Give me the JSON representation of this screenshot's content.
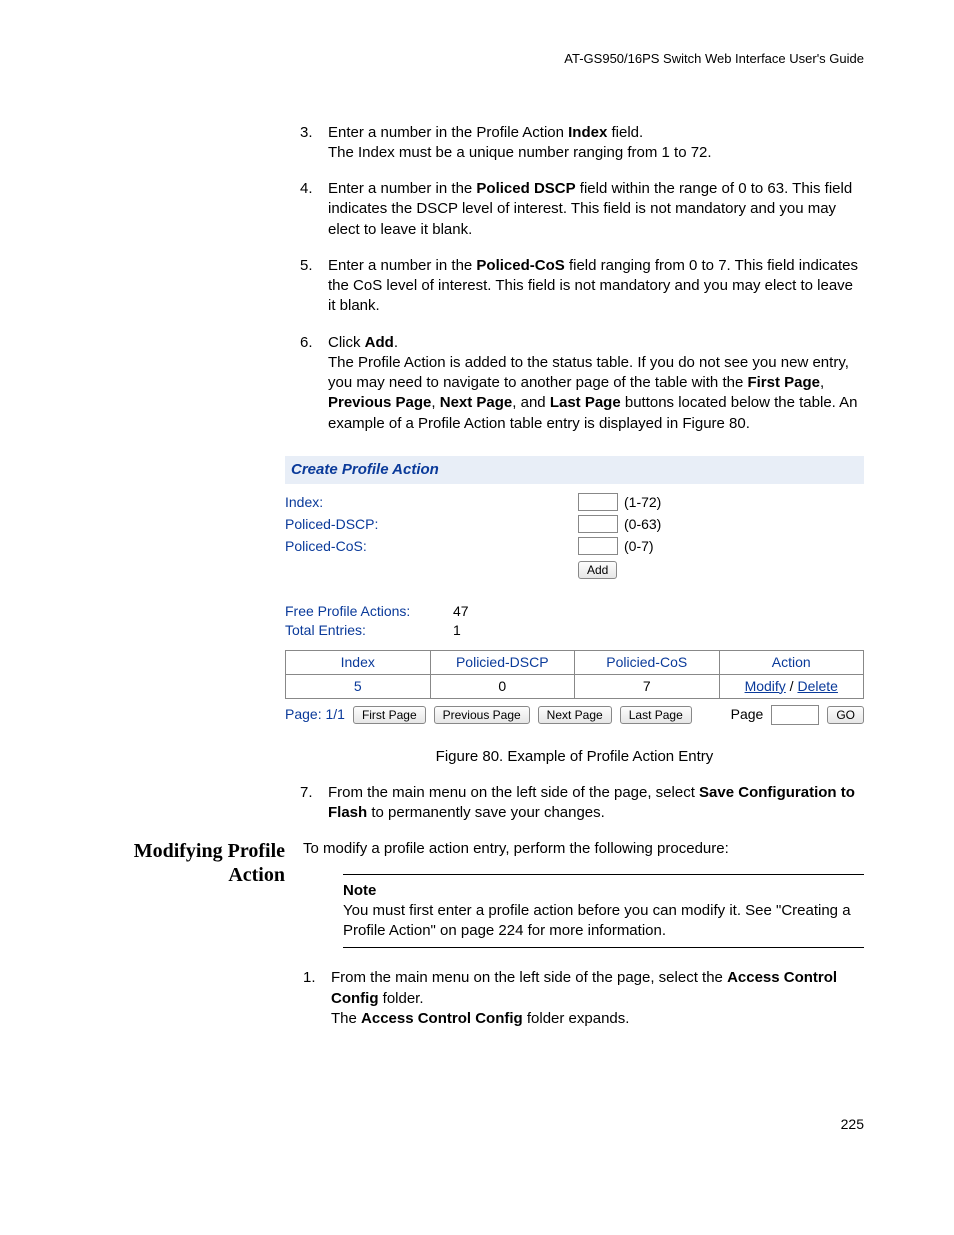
{
  "header": "AT-GS950/16PS Switch Web Interface User's Guide",
  "s3": {
    "n": "3.",
    "l1a": "Enter a number in the Profile Action ",
    "l1b": "Index",
    "l1c": " field.",
    "l2": "The Index must be a unique number ranging from 1 to 72."
  },
  "s4": {
    "n": "4.",
    "l1a": "Enter a number in the ",
    "l1b": "Policed DSCP",
    "l1c": " field within the range of 0 to 63. This field indicates the DSCP level of interest. This field is not mandatory and you may elect to leave it blank."
  },
  "s5": {
    "n": "5.",
    "l1a": "Enter a number in the ",
    "l1b": "Policed-CoS",
    "l1c": " field ranging from 0 to 7. This field indicates the CoS level of interest. This field is not mandatory and you may elect to leave it blank."
  },
  "s6": {
    "n": "6.",
    "l1a": "Click ",
    "l1b": "Add",
    "l1c": ".",
    "l2a": "The Profile Action is added to the status table. If you do not see you new entry, you may need to navigate to another page of the table with the ",
    "l2b": "First Page",
    "l2c": ", ",
    "l2d": "Previous Page",
    "l2e": ", ",
    "l2f": "Next Page",
    "l2g": ", and ",
    "l2h": "Last Page",
    "l2i": " buttons located below the table. An example of a Profile Action table entry is displayed in Figure 80."
  },
  "panel": {
    "title": "Create Profile Action",
    "rows": [
      {
        "label": "Index:",
        "hint": "(1-72)"
      },
      {
        "label": "Policed-DSCP:",
        "hint": "(0-63)"
      },
      {
        "label": "Policed-CoS:",
        "hint": "(0-7)"
      }
    ],
    "add": "Add",
    "stats": {
      "free_l": "Free Profile Actions:",
      "free_v": "47",
      "total_l": "Total Entries:",
      "total_v": "1"
    },
    "tbl": {
      "h": [
        "Index",
        "Policied-DSCP",
        "Policied-CoS",
        "Action"
      ],
      "row": {
        "c1": "5",
        "c2": "0",
        "c3": "7",
        "a1": "Modify",
        "sep": " / ",
        "a2": "Delete"
      }
    },
    "pager": {
      "label": "Page: 1/1",
      "first": "First Page",
      "prev": "Previous Page",
      "next": "Next Page",
      "last": "Last Page",
      "pl": "Page",
      "go": "GO"
    }
  },
  "caption": "Figure 80. Example of Profile Action Entry",
  "s7": {
    "n": "7.",
    "l1a": "From the main menu on the left side of the page, select ",
    "l1b": "Save Configuration to Flash",
    "l1c": " to permanently save your changes."
  },
  "section": {
    "title": "Modifying Profile Action",
    "intro": "To modify a profile action entry, perform the following procedure:",
    "note_l": "Note",
    "note_b": "You must first enter a profile action before you can modify it. See \"Creating a Profile Action\" on page 224 for more information."
  },
  "m1": {
    "n": "1.",
    "l1a": "From the main menu on the left side of the page, select the ",
    "l1b": "Access Control Config",
    "l1c": " folder.",
    "l2a": "The ",
    "l2b": "Access Control Config",
    "l2c": " folder expands."
  },
  "footer": "225"
}
